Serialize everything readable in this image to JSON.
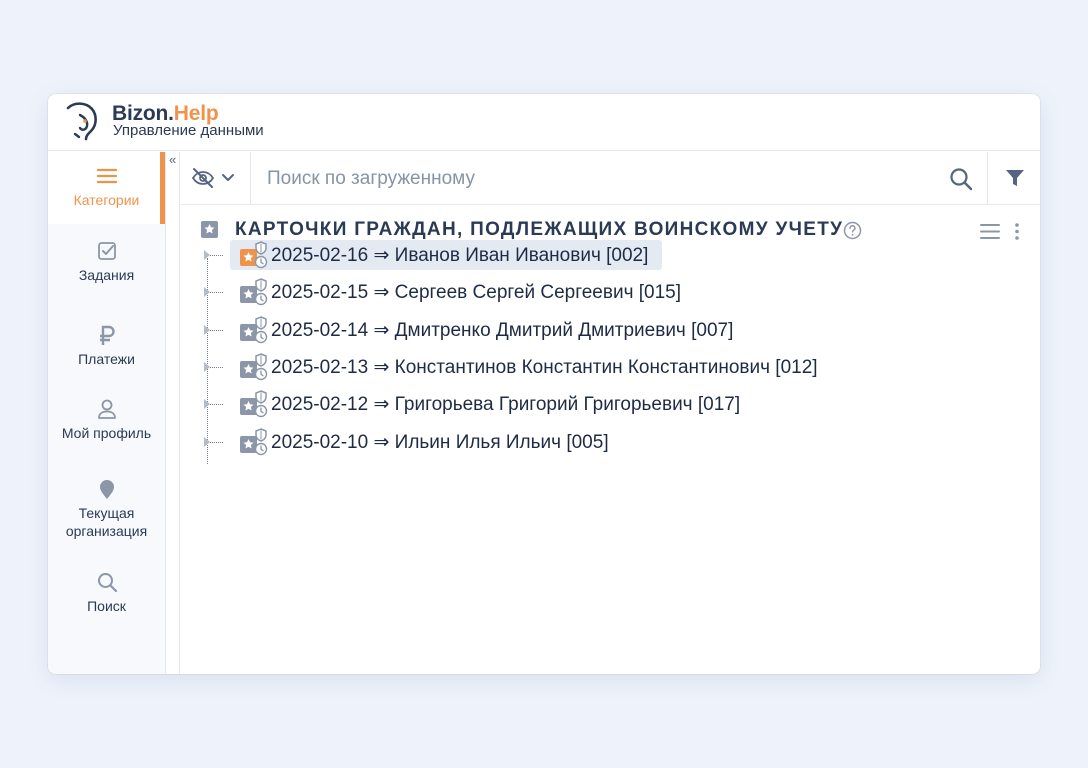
{
  "header": {
    "brand_main": "Bizon.",
    "brand_accent": "Help",
    "subtitle": "Управление данными",
    "logo_icon": "bison-head-logo"
  },
  "sidebar": {
    "collapse_label": "«",
    "items": [
      {
        "label": "Категории",
        "icon": "menu-icon",
        "active": true
      },
      {
        "label": "Задания",
        "icon": "checkbox-icon",
        "active": false
      },
      {
        "label": "Платежи",
        "icon": "ruble-icon",
        "active": false
      },
      {
        "label": "Мой профиль",
        "icon": "user-icon",
        "active": false
      },
      {
        "label": "Текущая организация",
        "line1": "Текущая",
        "line2": "организация",
        "icon": "location-pin-icon",
        "active": false
      },
      {
        "label": "Поиск",
        "icon": "search-icon",
        "active": false
      }
    ]
  },
  "toolbar": {
    "search_placeholder": "Поиск по загруженному",
    "search_value": "",
    "visibility_icon": "eye-off-icon",
    "dropdown_icon": "chevron-down-icon",
    "search_icon": "search-icon",
    "filter_icon": "filter-icon"
  },
  "main": {
    "title": "КАРТОЧКИ ГРАЖДАН, ПОДЛЕЖАЩИХ ВОИНСКОМУ УЧЕТУ",
    "title_icon": "star-square-icon",
    "help_icon": "question-circle-icon",
    "list_icon": "list-icon",
    "more_icon": "more-vertical-icon",
    "records": [
      {
        "text": "2025-02-16 ⇒ Иванов Иван Иванович [002]",
        "selected": true
      },
      {
        "text": "2025-02-15 ⇒ Сергеев Сергей Сергеевич [015]",
        "selected": false
      },
      {
        "text": "2025-02-14 ⇒ Дмитренко Дмитрий Дмитриевич [007]",
        "selected": false
      },
      {
        "text": "2025-02-13 ⇒ Константинов Константин Константинович [012]",
        "selected": false
      },
      {
        "text": "2025-02-12 ⇒ Григорьева Григорий Григорьевич [017]",
        "selected": false
      },
      {
        "text": "2025-02-10 ⇒ Ильин Илья Ильич [005]",
        "selected": false
      }
    ]
  },
  "colors": {
    "accent": "#f0934a",
    "text": "#2b3a55",
    "icon_gray": "#8b96a8",
    "selection": "#e4eaf2"
  }
}
